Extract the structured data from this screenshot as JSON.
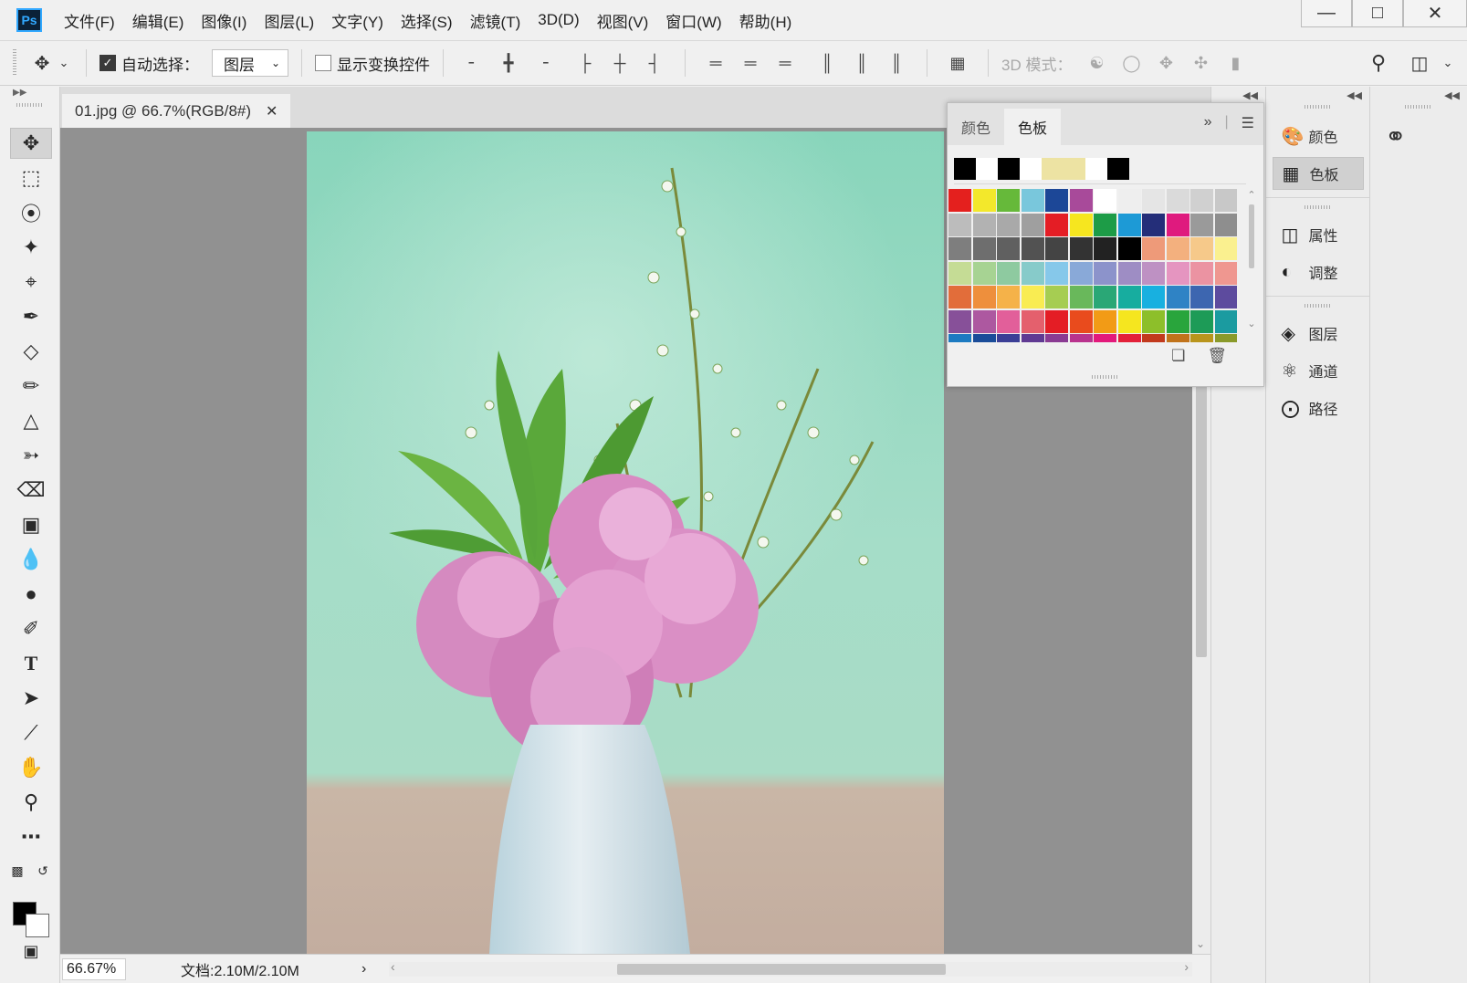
{
  "app": {
    "logo": "Ps"
  },
  "menu": [
    "文件(F)",
    "编辑(E)",
    "图像(I)",
    "图层(L)",
    "文字(Y)",
    "选择(S)",
    "滤镜(T)",
    "3D(D)",
    "视图(V)",
    "窗口(W)",
    "帮助(H)"
  ],
  "options": {
    "auto_select_label": "自动选择：",
    "auto_select_checked": true,
    "layer_select_value": "图层",
    "show_transform_label": "显示变换控件",
    "show_transform_checked": false,
    "mode_3d_label": "3D 模式："
  },
  "document": {
    "tab_title": "01.jpg @ 66.7%(RGB/8#)",
    "zoom": "66.67%",
    "doc_info": "文档:2.10M/2.10M"
  },
  "swatches_panel": {
    "tabs": [
      "颜色",
      "色板"
    ],
    "active_tab": "色板",
    "recent": [
      "#000000",
      "#ffffff",
      "#000000",
      "#ffffff",
      "#ede3a3",
      "#ede3a3",
      "#ffffff",
      "#000000"
    ],
    "grid": [
      [
        "#e4201e",
        "#f3e82b",
        "#66b93a",
        "#79c7dc",
        "#1c4797",
        "#a84a9a",
        "#ffffff",
        "#eeeeee",
        "#e5e5e5",
        "#dadada",
        "#d0d0d0",
        "#c8c8c8"
      ],
      [
        "#bcbcbc",
        "#b2b2b2",
        "#a9a9a9",
        "#9f9f9f",
        "#e41d25",
        "#f6e61f",
        "#1d9c47",
        "#1d9ad6",
        "#242e79",
        "#df1a7e",
        "#9a9a9a",
        "#8e8e8e"
      ],
      [
        "#7e7e7e",
        "#6e6e6e",
        "#606060",
        "#525252",
        "#444444",
        "#333333",
        "#222222",
        "#000000",
        "#ee9a79",
        "#f3b07e",
        "#f6c98a",
        "#faf08f"
      ],
      [
        "#c5dc95",
        "#a7d393",
        "#8ecaa0",
        "#87cbca",
        "#86c8ea",
        "#89a9d8",
        "#8c93cb",
        "#9e8dc4",
        "#be91c3",
        "#e595c0",
        "#eb93a2",
        "#ef9790"
      ],
      [
        "#e26d3a",
        "#ee8f3c",
        "#f5b249",
        "#f9ec52",
        "#a6cd52",
        "#69b85b",
        "#2aa776",
        "#17ad9f",
        "#18b0e0",
        "#2f83c5",
        "#3d66b0",
        "#5d4b9e"
      ],
      [
        "#875099",
        "#ad58a0",
        "#e25f9a",
        "#e4606d",
        "#e41d25",
        "#e94b1d",
        "#f29b16",
        "#f5e61f",
        "#8dbf2a",
        "#29a53c",
        "#1d9b57",
        "#1b9ba0"
      ],
      [
        "#1c7ac1",
        "#1a4c99",
        "#3b3e96",
        "#603a93",
        "#8a3b93",
        "#b9338e",
        "#e3197b",
        "#e32139",
        "#c23a1d",
        "#c1731b",
        "#b9951c",
        "#8a9a2a"
      ]
    ]
  },
  "dock": {
    "group1": [
      {
        "icon": "palette-icon",
        "label": "颜色",
        "active": false
      },
      {
        "icon": "grid-icon",
        "label": "色板",
        "active": true
      }
    ],
    "group2": [
      {
        "icon": "properties-icon",
        "label": "属性",
        "active": false
      },
      {
        "icon": "adjustments-icon",
        "label": "调整",
        "active": false
      }
    ],
    "group3": [
      {
        "icon": "layers-icon",
        "label": "图层",
        "active": false
      },
      {
        "icon": "channels-icon",
        "label": "通道",
        "active": false
      },
      {
        "icon": "paths-icon",
        "label": "路径",
        "active": false
      }
    ]
  },
  "colors": {
    "canvas_bg": "#919191",
    "photo_bg_top": "#8fd6bd",
    "photo_table": "#c8b2a4"
  }
}
